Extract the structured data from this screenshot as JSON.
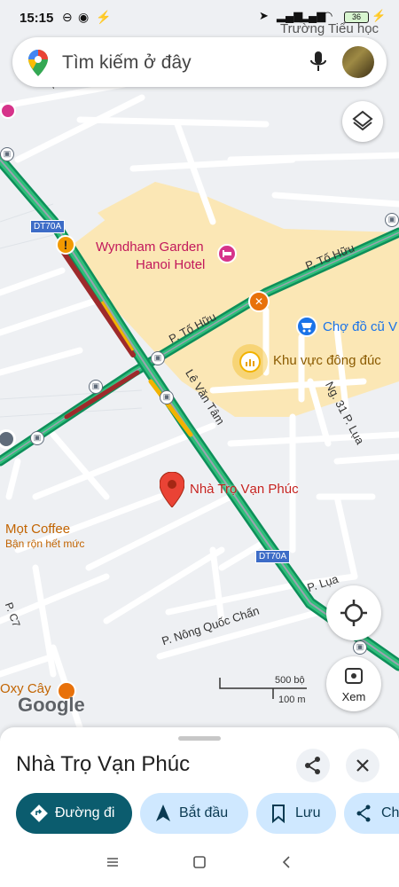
{
  "status_bar": {
    "time": "15:15",
    "battery": "36"
  },
  "search": {
    "placeholder": "Tìm kiếm ở đây"
  },
  "map": {
    "labels": {
      "truong_tieu_hoc": "Trường Tiểu học",
      "dt70a_top": "DT70A",
      "dt70a_bottom": "DT70A",
      "wyndham_line1": "Wyndham Garden",
      "wyndham_line2": "Hanoi Hotel",
      "p_to_huu_right": "P. Tố Hữu",
      "p_to_huu_left": "P. Tố Hữu",
      "cho_do_cu": "Chợ đồ cũ V",
      "khu_vuc_dong_duc": "Khu vực đông đúc",
      "le_van_tam": "Lê Văn Tâm",
      "ng31_p_lua": "Ng. 31 P. Lụa",
      "nha_tro_van_phuc": "Nhà Trọ Vạn Phúc",
      "moc_coffee": "Mọt Coffee",
      "ban_ron": "Bận rộn hết mức",
      "p_nong_quoc_chan": "P. Nông Quốc Chấn",
      "p_lua": "P. Lụa",
      "oxy_cay": "Oxy Cây",
      "p_c7": "P. C7",
      "p_top_left": "P.",
      "google": "Google"
    },
    "scale": {
      "top": "500 bộ",
      "bottom": "100 m"
    },
    "colors": {
      "traffic_green": "#1aa260",
      "traffic_red": "#9e2a2b",
      "traffic_orange": "#f2b300",
      "pin_red": "#ea4335",
      "poi_orange": "#e8710a",
      "poi_blue": "#1a73e8",
      "poi_pink": "#d6338a"
    }
  },
  "buttons": {
    "xem": "Xem"
  },
  "sheet": {
    "title": "Nhà Trọ Vạn Phúc",
    "chips": {
      "directions": "Đường đi",
      "start": "Bắt đầu",
      "save": "Lưu",
      "share": "Ch"
    }
  }
}
